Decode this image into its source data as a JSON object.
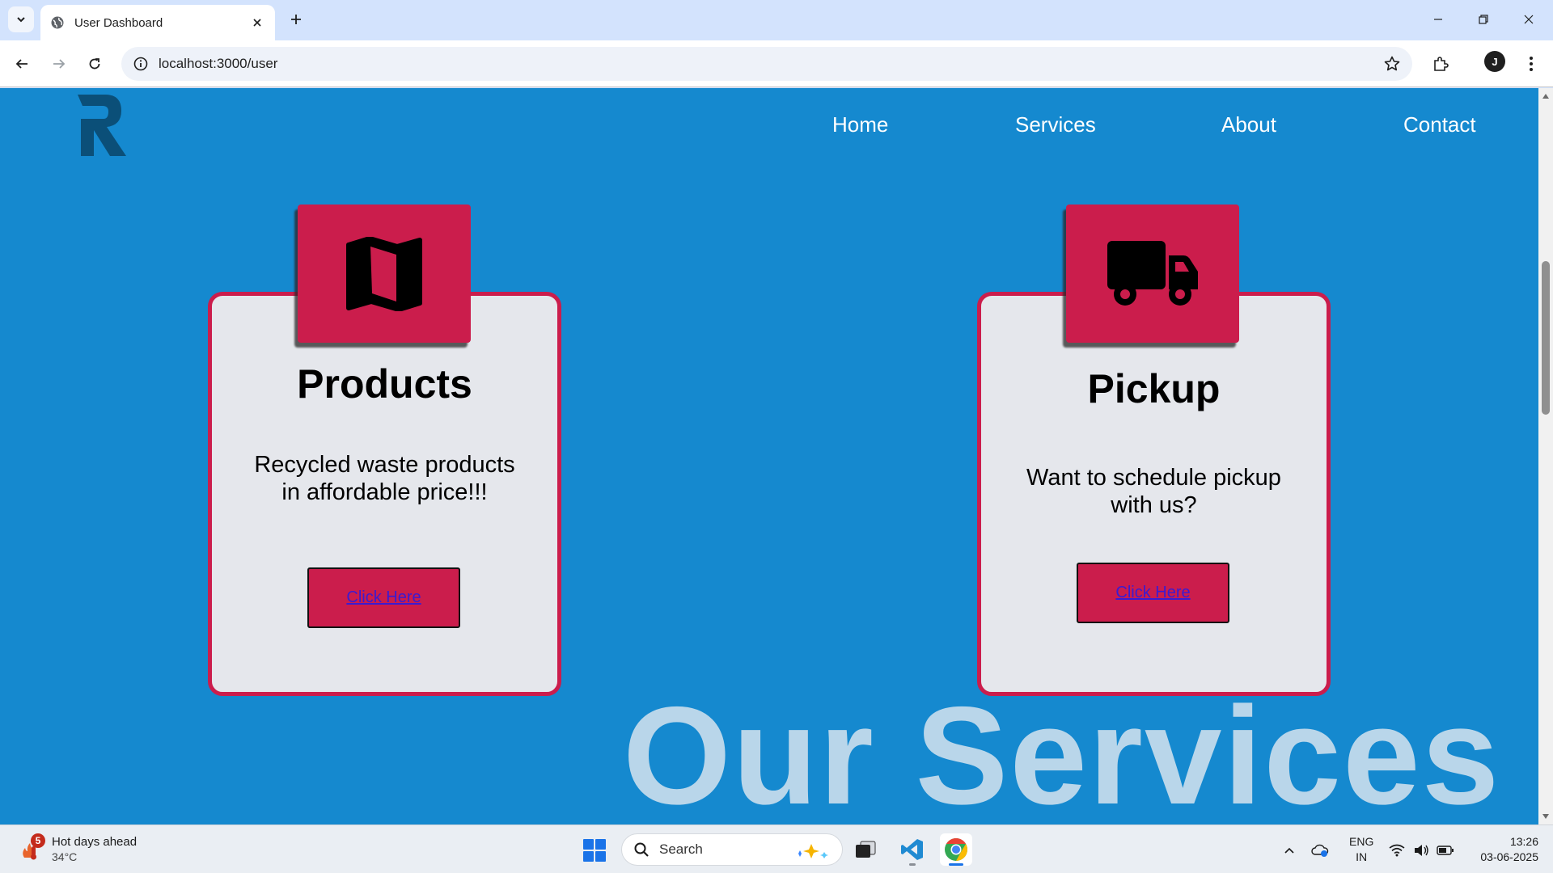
{
  "browser": {
    "tab_title": "User Dashboard",
    "url": "localhost:3000/user",
    "profile_initial": "J"
  },
  "site": {
    "logo_letter": "R",
    "nav": [
      "Home",
      "Services",
      "About",
      "Contact"
    ]
  },
  "cards": [
    {
      "icon": "map-icon",
      "title": "Products",
      "description": "Recycled waste products in affordable price!!!",
      "button_label": "Click Here"
    },
    {
      "icon": "truck-icon",
      "title": "Pickup",
      "description": "Want to schedule pickup with us?",
      "button_label": "Click Here"
    }
  ],
  "section_heading": "Our Services",
  "colors": {
    "page_background": "#1589cf",
    "card_accent": "#cb1d4c",
    "card_background": "#e5e7ec",
    "heading_watermark": "#b9d6ea",
    "link": "#3b1bd1"
  },
  "taskbar": {
    "weather_badge": "5",
    "weather_title": "Hot days ahead",
    "weather_temp": "34°C",
    "search_label": "Search",
    "language_line1": "ENG",
    "language_line2": "IN",
    "time": "13:26",
    "date": "03-06-2025"
  }
}
